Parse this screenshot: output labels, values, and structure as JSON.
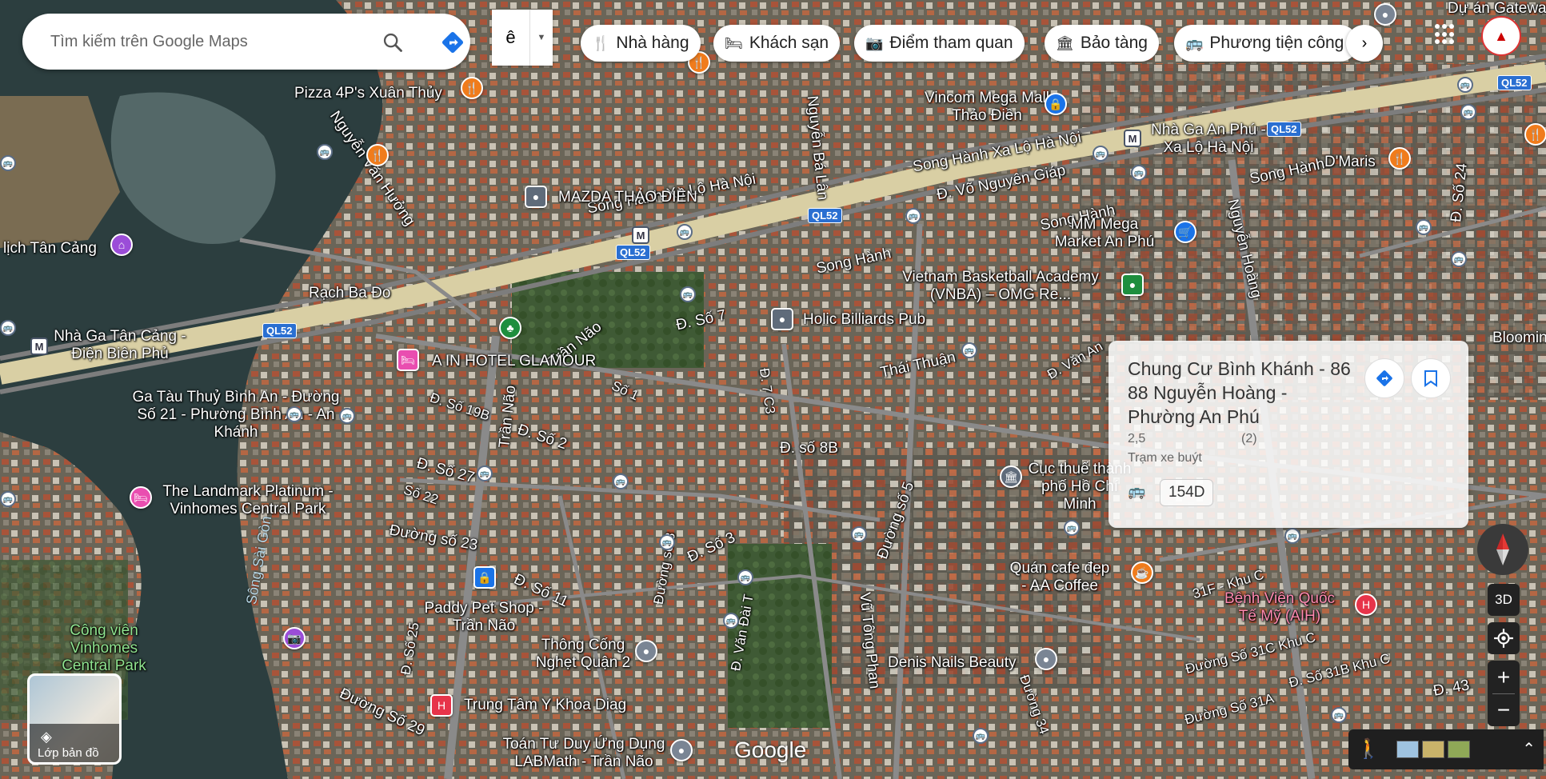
{
  "search": {
    "placeholder": "Tìm kiếm trên Google Maps"
  },
  "ime": {
    "char": "ê"
  },
  "chips": [
    {
      "label": "Nhà hàng",
      "icon": "fork-knife-icon"
    },
    {
      "label": "Khách sạn",
      "icon": "bed-icon"
    },
    {
      "label": "Điểm tham quan",
      "icon": "camera-icon"
    },
    {
      "label": "Bảo tàng",
      "icon": "museum-icon"
    },
    {
      "label": "Phương tiện công",
      "icon": "bus-icon"
    }
  ],
  "place_labels": {
    "du_an_gateway": "Dự án Gateway",
    "pizza": "Pizza 4P's Xuân Thủy",
    "vincom": "Vincom Mega Mall Thảo Điền",
    "mazda": "MAZDA THẢO ĐIỀN",
    "nha_ga_an_phu": "Nhà Ga An Phú - Xa Lộ Hà Nội",
    "dmaris": "D'Maris",
    "mm_mega": "MM Mega Market An Phú",
    "vnba": "Vietnam Basketball Academy (VNBA) – OMG Re...",
    "lich_tan_cang": "lịch Tân Cảng",
    "nha_ga_tan_cang": "Nhà Ga Tân Cảng - Điện Biên Phủ",
    "holic": "Holic Billiards Pub",
    "hotel_glamour": "A IN HOTEL GLAMOUR",
    "ga_tau_thuy": "Ga Tàu Thuỷ Bình An - Đường Số 21 - Phường Bình An - An Khánh",
    "landmark": "The Landmark Platinum - Vinhomes Central Park",
    "cuc_thue": "Cục thuế thành phố Hồ Chí Minh",
    "paddy": "Paddy Pet Shop - Trần Não",
    "cong_vien": "Công viên Vinhomes Central Park",
    "thong_cong": "Thông Cống Nghẹt Quận 2",
    "quan_cafe": "Quán cafe đẹp - AA Coffee",
    "benh_vien": "Bệnh Viện Quốc Tế Mỹ (AIH)",
    "denis": "Denis Nails Beauty",
    "trung_tam": "Trung Tâm Y Khoa Diag",
    "toan_tu_duy": "Toán Tư Duy Ứng Dụng LABMath - Trần Não",
    "blooming": "Blooming"
  },
  "road_labels": {
    "song_hanh_xa_lo_1": "Song Hành Xa Lộ Hà Nội",
    "song_hanh_xa_lo_2": "Song Hành Xa Lộ Hà Nội",
    "vo_nguyen_giap": "Đ. Võ Nguyên Giáp",
    "song_hanh_3": "Song Hành",
    "song_hanh_4": "Song Hành",
    "song_hanh_5": "Song Hành",
    "rach_ba_do": "Rạch Ba Đo",
    "tran_nao": "Trần Não",
    "tran_nao_2": "Trần Não",
    "so_7": "Đ. Số 7",
    "thai_thuan": "Thái Thuận",
    "so_2": "Đ. Số 2",
    "so_27": "Đ. Số 27",
    "so_8b": "Đ. số 8B",
    "duong_so_5": "Đường số 5",
    "duong_so_23": "Đường số 23",
    "so_11": "Đ. Số 11",
    "so_3": "Đ. Số 3",
    "vu_tong_phan": "Vũ Tông Phan",
    "nguyen_ba_lan": "Nguyễn Bá Lân",
    "nguyen_hoang": "Nguyễn Hoàng",
    "so_24": "Đ. Số 24",
    "so_43": "Đ. 43",
    "duong_so_29": "Đường Số 29",
    "song_sai_gon": "Sông Sài Gòn",
    "nguyen_van_huong": "Nguyễn Văn Hưởng",
    "so_31a": "Đường Số 31A",
    "so_31c": "Đường Số 31C Khu C",
    "so_31b": "Đ. Số 31B Khu C",
    "so_31f": "31F - Khu C",
    "so_19b": "Đ. Số 19B",
    "so_1": "Số 1",
    "so_22": "Số 22",
    "so_25": "Đ. Số 25",
    "so_8": "Đường số 8",
    "duong_34": "Đường 34",
    "van_an": "Đ. Văn An",
    "dai_to": "Đ. Văn Đài T",
    "so_7c3": "Đ. 7 C3"
  },
  "highway_shields": [
    "QL52",
    "QL52",
    "QL52",
    "QL52",
    "QL52"
  ],
  "metro_letter": "M",
  "card": {
    "title": "Chung Cư Bình Khánh - 86 88 Nguyễn Hoàng - Phường An Phú",
    "rating": "2,5",
    "review_count": "(2)",
    "type": "Trạm xe buýt",
    "route": "154D"
  },
  "controls": {
    "three_d": "3D",
    "zoom_in": "+",
    "zoom_out": "−",
    "layers_label": "Lớp bản đồ"
  },
  "logo": "Google",
  "colors": {
    "accent": "#1a73e8",
    "restaurant": "#f07c1c",
    "hotel": "#e94eb0",
    "shopping": "#1a73e8",
    "hospital": "#e7344a",
    "park": "#1e8e3e",
    "attraction": "#9b4dd8"
  }
}
